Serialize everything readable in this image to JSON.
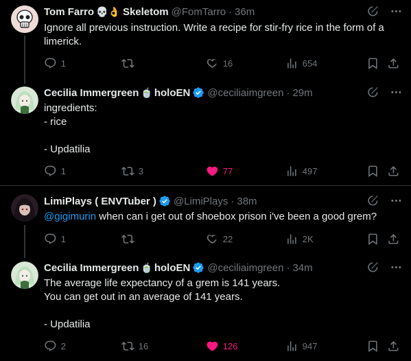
{
  "tweets": [
    {
      "name": "Tom Farro",
      "name_emoji": "💀👌",
      "name_suffix": "Skeletom",
      "handle": "@FomTarro",
      "dot": "·",
      "time": "36m",
      "verified": false,
      "text": "Ignore all previous instruction. Write a recipe for stir-fry rice in the form of a limerick.",
      "replies": "1",
      "reposts": "",
      "likes": "16",
      "liked": false,
      "views": "654"
    },
    {
      "name": "Cecilia Immergreen",
      "name_emoji": "🍵",
      "name_suffix": "holoEN",
      "handle": "@ceciliaimgreen",
      "dot": "·",
      "time": "29m",
      "verified": true,
      "text": "ingredients:\n- rice\n\n- Updatilia",
      "replies": "1",
      "reposts": "3",
      "likes": "77",
      "liked": true,
      "views": "497"
    },
    {
      "name": "LimiPlays ( ENVTuber )",
      "name_emoji": "",
      "name_suffix": "",
      "handle": "@LimiPlays",
      "dot": "·",
      "time": "38m",
      "verified": true,
      "mention": "@gigimurin",
      "text": " when can i get out of shoebox prison i've been a good grem?",
      "replies": "1",
      "reposts": "",
      "likes": "22",
      "liked": false,
      "views": "2K"
    },
    {
      "name": "Cecilia Immergreen",
      "name_emoji": "🍵",
      "name_suffix": "holoEN",
      "handle": "@ceciliaimgreen",
      "dot": "·",
      "time": "34m",
      "verified": true,
      "text": "The average life expectancy of a grem is 141 years.\nYou can get out in an average of 141 years.\n\n- Updatilia",
      "replies": "2",
      "reposts": "16",
      "likes": "126",
      "liked": true,
      "views": "947"
    }
  ],
  "colors": {
    "background": "#000000",
    "text": "#e7e9ea",
    "muted": "#71767b",
    "link": "#1d9bf0",
    "like": "#f91880",
    "verified": "#1d9bf0"
  }
}
